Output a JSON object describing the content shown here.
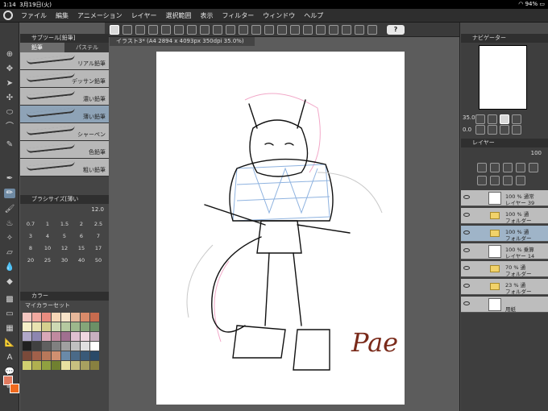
{
  "status": {
    "time": "1:14",
    "date": "3月19日(火)",
    "battery": "94%"
  },
  "menu": [
    "ファイル",
    "編集",
    "アニメーション",
    "レイヤー",
    "選択範囲",
    "表示",
    "フィルター",
    "ウィンドウ",
    "ヘルプ"
  ],
  "toolbar": {
    "help_label": "?"
  },
  "subtool": {
    "title": "サブツール[鉛筆]",
    "tab_pencil": "鉛筆",
    "tab_pastel": "パステル",
    "brushes": [
      "リアル鉛筆",
      "デッサン鉛筆",
      "濃い鉛筆",
      "薄い鉛筆",
      "シャーペン",
      "色鉛筆",
      "粗い鉛筆"
    ]
  },
  "brushsize": {
    "title": "ブラシサイズ[薄い",
    "value": "12.0",
    "sizes": [
      "0.7",
      "1",
      "1.5",
      "2",
      "2.5",
      "3",
      "4",
      "5",
      "6",
      "7",
      "8",
      "10",
      "12",
      "15",
      "17",
      "20",
      "25",
      "30",
      "40",
      "50"
    ]
  },
  "color": {
    "title": "カラー",
    "set_name": "マイカラーセット",
    "main_color": "#e07a5f",
    "sub_color": "#f06a1e",
    "palette": [
      "#f3c6c0",
      "#f2a9a0",
      "#e98c80",
      "#f7d7b6",
      "#f7e3c8",
      "#e6b79a",
      "#d98b6a",
      "#c76b4e",
      "#f6f0c8",
      "#e9e3b0",
      "#d5d08e",
      "#cdd9b3",
      "#b5c9a0",
      "#9db88c",
      "#85a679",
      "#6c9066",
      "#b0a8c8",
      "#8d86b0",
      "#d8a8b8",
      "#c08aa0",
      "#a07090",
      "#e0c0d0",
      "#f0d8e0",
      "#c8b0c0",
      "#202020",
      "#404040",
      "#606060",
      "#808080",
      "#a0a0a0",
      "#c0c0c0",
      "#e0e0e0",
      "#ffffff",
      "#7a4a3a",
      "#a0604a",
      "#b8785a",
      "#d09070",
      "#6a8aa8",
      "#4a6a88",
      "#3a5a78",
      "#2a4a68",
      "#d0d070",
      "#b0b050",
      "#90a040",
      "#708030",
      "#e8e0a0",
      "#c8c080",
      "#a8a060",
      "#888040"
    ]
  },
  "document": {
    "tab_label": "イラスト3* (A4 2894 x 4093px 350dpi 35.0%)",
    "signature": "Pae"
  },
  "navigator": {
    "title": "ナビゲーター",
    "zoom": "35.0",
    "rotation": "0.0"
  },
  "layers": {
    "title": "レイヤー",
    "opacity_value": "100",
    "rows": [
      {
        "line1": "100 % 通常",
        "line2": "レイヤー 39",
        "kind": "layer",
        "selected": false
      },
      {
        "line1": "100 % 通",
        "line2": "フォルダー",
        "kind": "folder",
        "selected": false
      },
      {
        "line1": "100 % 通",
        "line2": "フォルダー",
        "kind": "folder",
        "selected": true
      },
      {
        "line1": "100 % 乗算",
        "line2": "レイヤー 14",
        "kind": "layer",
        "selected": false
      },
      {
        "line1": "70 % 通",
        "line2": "フォルダー",
        "kind": "folder",
        "selected": false
      },
      {
        "line1": "23 % 通",
        "line2": "フォルダー",
        "kind": "folder",
        "selected": false
      },
      {
        "line1": "",
        "line2": "用紙",
        "kind": "paper",
        "selected": false
      }
    ]
  }
}
